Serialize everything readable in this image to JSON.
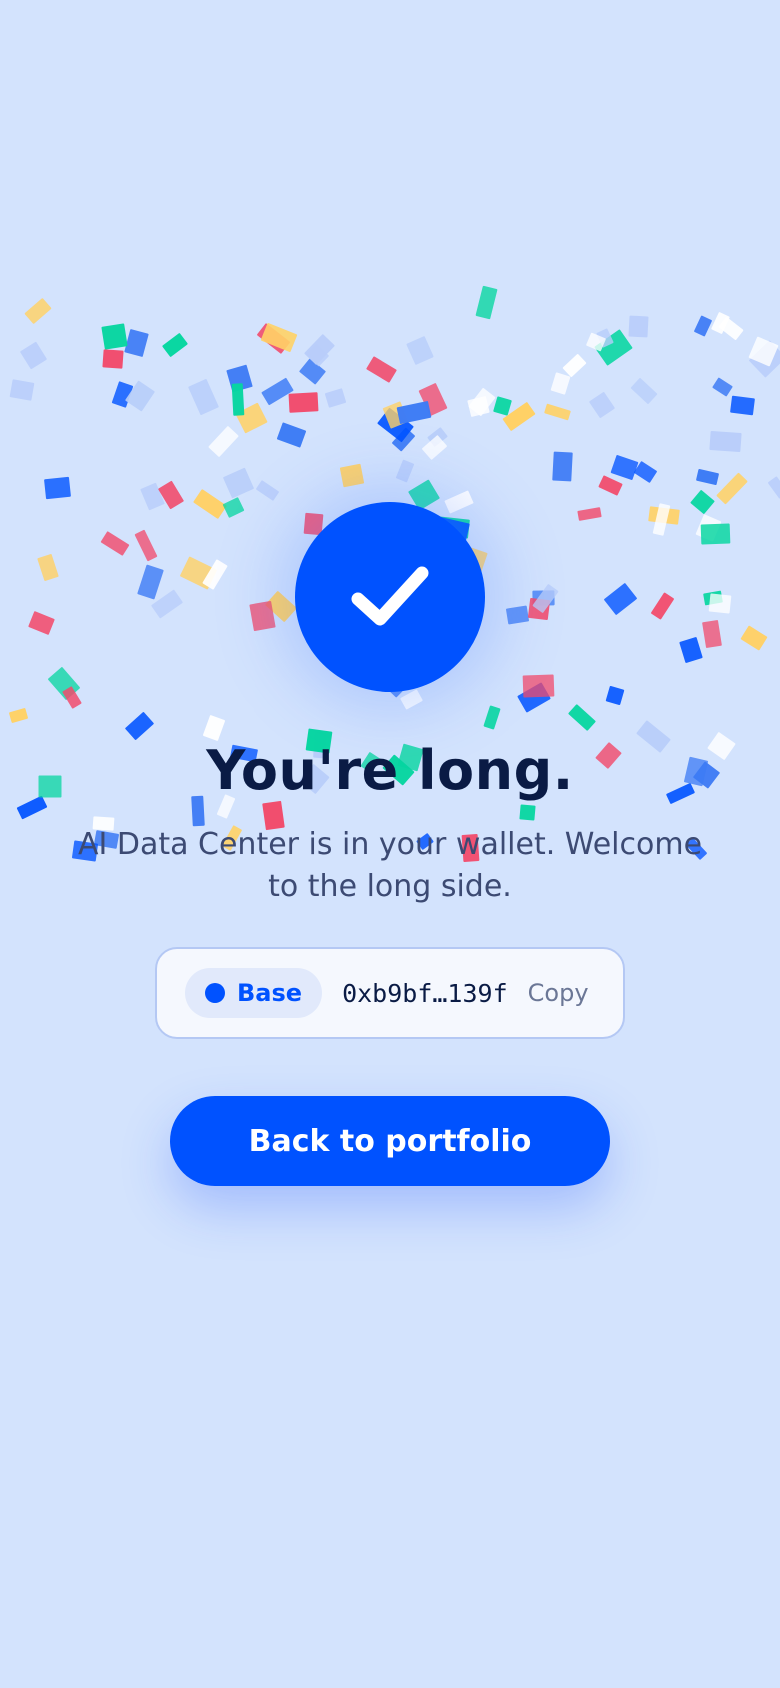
{
  "success": {
    "icon": "checkmark-icon",
    "headline": "You're long.",
    "subtext": "AI Data Center is in your wallet. Welcome to the long side."
  },
  "wallet": {
    "network_label": "Base",
    "address": "0xb9bf…139f",
    "copy_label": "Copy"
  },
  "cta": {
    "label": "Back to portfolio"
  },
  "colors": {
    "background": "#d3e3fd",
    "accent": "#0052ff",
    "heading": "#0a1b45",
    "body_text": "#3c4a73",
    "confetti": [
      "#0052ff",
      "#3d7bf5",
      "#f24a6b",
      "#ffd166",
      "#06d6a0",
      "#ffffff",
      "#b8cdfa"
    ]
  }
}
